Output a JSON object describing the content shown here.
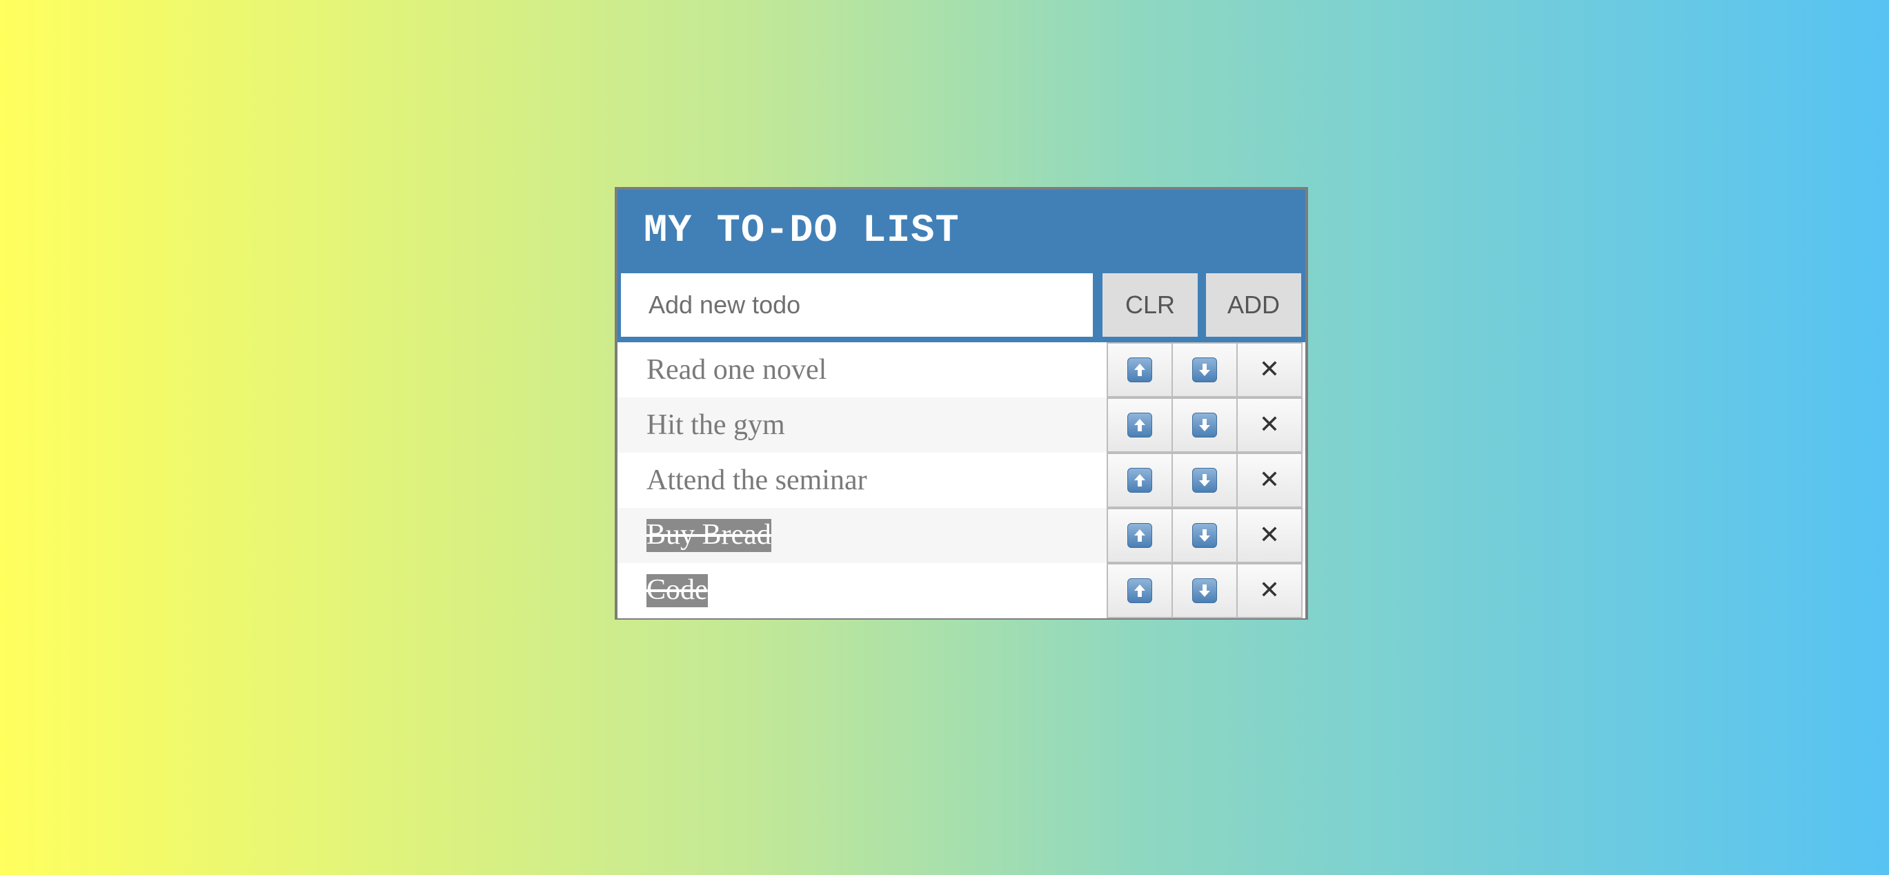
{
  "app": {
    "title": "MY TO-DO LIST"
  },
  "input_bar": {
    "placeholder": "Add new todo",
    "value": "",
    "clear_label": "CLR",
    "add_label": "ADD"
  },
  "todos": [
    {
      "text": "Read one novel",
      "done": false
    },
    {
      "text": "Hit the gym",
      "done": false
    },
    {
      "text": "Attend the seminar",
      "done": false
    },
    {
      "text": "Buy Bread",
      "done": true
    },
    {
      "text": "Code",
      "done": true
    }
  ],
  "icons": {
    "move_up": "arrow-up-icon",
    "move_down": "arrow-down-icon",
    "delete": "close-icon",
    "delete_glyph": "✕"
  },
  "colors": {
    "header_bg": "#4180b7",
    "done_highlight": "#8a8a8a",
    "gradient_start": "#ffff5e",
    "gradient_end": "#57c3f3"
  }
}
